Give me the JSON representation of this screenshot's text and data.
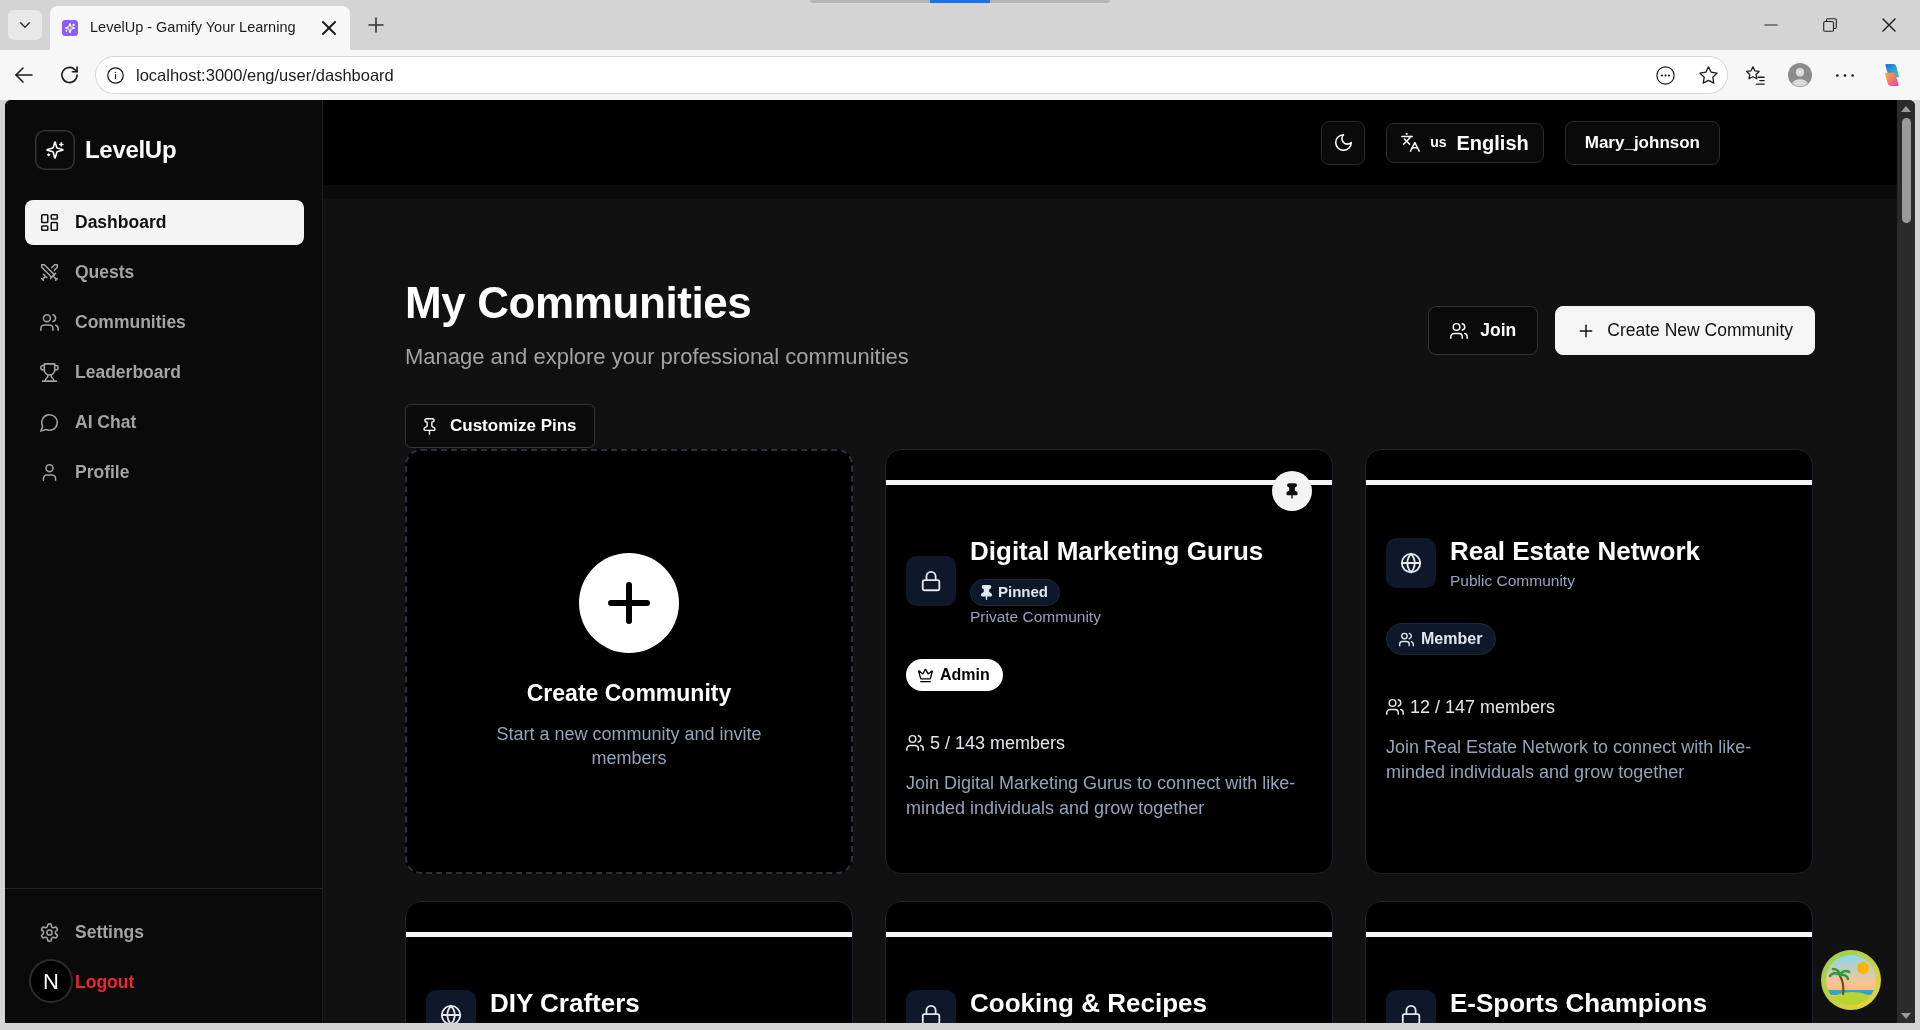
{
  "browser": {
    "tab_title": "LevelUp - Gamify Your Learning",
    "url": "localhost:3000/eng/user/dashboard"
  },
  "sidebar": {
    "brand": "LevelUp",
    "items": [
      {
        "label": "Dashboard",
        "kind": "dashboard",
        "selected": true
      },
      {
        "label": "Quests",
        "kind": "quests",
        "selected": false
      },
      {
        "label": "Communities",
        "kind": "communities",
        "selected": false
      },
      {
        "label": "Leaderboard",
        "kind": "leaderboard",
        "selected": false
      },
      {
        "label": "AI Chat",
        "kind": "chat",
        "selected": false
      },
      {
        "label": "Profile",
        "kind": "profile",
        "selected": false
      }
    ],
    "footer": [
      {
        "label": "Settings",
        "kind": "settings"
      },
      {
        "label": "Logout",
        "kind": "logout"
      }
    ]
  },
  "header": {
    "language_code": "us",
    "language": "English",
    "user": "Mary_johnson"
  },
  "page": {
    "title": "My Communities",
    "subtitle": "Manage and explore your professional communities",
    "actions": [
      {
        "label": "Join",
        "kind": "join"
      },
      {
        "label": "Create New Community",
        "kind": "create"
      }
    ],
    "customize_pins": "Customize Pins"
  },
  "create_card": {
    "title": "Create Community",
    "text": "Start a new community and invite members"
  },
  "communities": [
    {
      "name": "Digital Marketing Gurus",
      "kind": "private",
      "privacy_label": "Private Community",
      "pinned": true,
      "pin_label": "Pinned",
      "role": {
        "kind": "admin",
        "label": "Admin"
      },
      "members": "5 / 143 members",
      "description": "Join Digital Marketing Gurus to connect with like-minded individuals and grow together"
    },
    {
      "name": "Real Estate Network",
      "kind": "public",
      "privacy_label": "Public Community",
      "pinned": false,
      "role": {
        "kind": "member",
        "label": "Member"
      },
      "members": "12 / 147 members",
      "description": "Join Real Estate Network to connect with like-minded individuals and grow together"
    },
    {
      "name": "DIY Crafters",
      "kind": "public",
      "pinned": false
    },
    {
      "name": "Cooking & Recipes",
      "kind": "private",
      "pinned": false
    },
    {
      "name": "E-Sports Champions",
      "kind": "private",
      "pinned": false
    }
  ],
  "dev_indicator": "N"
}
